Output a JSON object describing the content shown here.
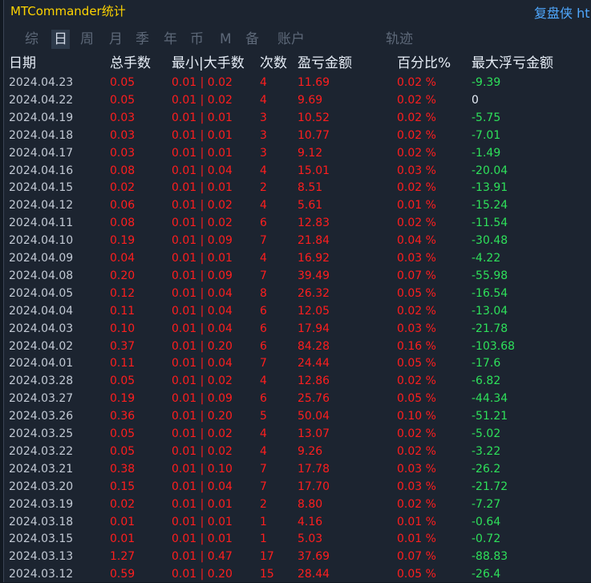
{
  "app": {
    "title": "MTCommander统计",
    "brand": "复盘侠 ht"
  },
  "tabs": [
    {
      "label": "综"
    },
    {
      "label": "日"
    },
    {
      "label": "周"
    },
    {
      "label": "月"
    },
    {
      "label": "季"
    },
    {
      "label": "年"
    },
    {
      "label": "币"
    },
    {
      "label": "M"
    },
    {
      "label": "备"
    },
    {
      "label": "账户"
    },
    {
      "label": "轨迹"
    }
  ],
  "active_tab": "日",
  "columns": {
    "date": "日期",
    "total_lots": "总手数",
    "min_max_lots": "最小|大手数",
    "count": "次数",
    "pnl": "盈亏金额",
    "percent": "百分比%",
    "max_float_loss": "最大浮亏金额"
  },
  "colors": {
    "background": "#1c2430",
    "title": "#ffd400",
    "brand": "#4fa8ff",
    "loss_red": "#ff1e1e",
    "float_green": "#2ee05a",
    "date_gray": "#c2c9d4"
  },
  "rows": [
    {
      "date": "2024.04.23",
      "lots": "0.05",
      "range": "0.01 | 0.02",
      "count": "4",
      "pnl": "11.69",
      "pct": "0.02 %",
      "float": "-9.39"
    },
    {
      "date": "2024.04.22",
      "lots": "0.05",
      "range": "0.01 | 0.02",
      "count": "4",
      "pnl": "9.69",
      "pct": "0.02 %",
      "float": "0"
    },
    {
      "date": "2024.04.19",
      "lots": "0.03",
      "range": "0.01 | 0.01",
      "count": "3",
      "pnl": "10.52",
      "pct": "0.02 %",
      "float": "-5.75"
    },
    {
      "date": "2024.04.18",
      "lots": "0.03",
      "range": "0.01 | 0.01",
      "count": "3",
      "pnl": "10.77",
      "pct": "0.02 %",
      "float": "-7.01"
    },
    {
      "date": "2024.04.17",
      "lots": "0.03",
      "range": "0.01 | 0.01",
      "count": "3",
      "pnl": "9.12",
      "pct": "0.02 %",
      "float": "-1.49"
    },
    {
      "date": "2024.04.16",
      "lots": "0.08",
      "range": "0.01 | 0.04",
      "count": "4",
      "pnl": "15.01",
      "pct": "0.03 %",
      "float": "-20.04"
    },
    {
      "date": "2024.04.15",
      "lots": "0.02",
      "range": "0.01 | 0.01",
      "count": "2",
      "pnl": "8.51",
      "pct": "0.02 %",
      "float": "-13.91"
    },
    {
      "date": "2024.04.12",
      "lots": "0.06",
      "range": "0.01 | 0.02",
      "count": "4",
      "pnl": "5.61",
      "pct": "0.01 %",
      "float": "-15.24"
    },
    {
      "date": "2024.04.11",
      "lots": "0.08",
      "range": "0.01 | 0.02",
      "count": "6",
      "pnl": "12.83",
      "pct": "0.02 %",
      "float": "-11.54"
    },
    {
      "date": "2024.04.10",
      "lots": "0.19",
      "range": "0.01 | 0.09",
      "count": "7",
      "pnl": "21.84",
      "pct": "0.04 %",
      "float": "-30.48"
    },
    {
      "date": "2024.04.09",
      "lots": "0.04",
      "range": "0.01 | 0.01",
      "count": "4",
      "pnl": "16.92",
      "pct": "0.03 %",
      "float": "-4.22"
    },
    {
      "date": "2024.04.08",
      "lots": "0.20",
      "range": "0.01 | 0.09",
      "count": "7",
      "pnl": "39.49",
      "pct": "0.07 %",
      "float": "-55.98"
    },
    {
      "date": "2024.04.05",
      "lots": "0.12",
      "range": "0.01 | 0.04",
      "count": "8",
      "pnl": "26.32",
      "pct": "0.05 %",
      "float": "-16.54"
    },
    {
      "date": "2024.04.04",
      "lots": "0.11",
      "range": "0.01 | 0.04",
      "count": "6",
      "pnl": "12.05",
      "pct": "0.02 %",
      "float": "-13.04"
    },
    {
      "date": "2024.04.03",
      "lots": "0.10",
      "range": "0.01 | 0.04",
      "count": "6",
      "pnl": "17.94",
      "pct": "0.03 %",
      "float": "-21.78"
    },
    {
      "date": "2024.04.02",
      "lots": "0.37",
      "range": "0.01 | 0.20",
      "count": "6",
      "pnl": "84.28",
      "pct": "0.16 %",
      "float": "-103.68"
    },
    {
      "date": "2024.04.01",
      "lots": "0.11",
      "range": "0.01 | 0.04",
      "count": "7",
      "pnl": "24.44",
      "pct": "0.05 %",
      "float": "-17.6"
    },
    {
      "date": "2024.03.28",
      "lots": "0.05",
      "range": "0.01 | 0.02",
      "count": "4",
      "pnl": "12.86",
      "pct": "0.02 %",
      "float": "-6.82"
    },
    {
      "date": "2024.03.27",
      "lots": "0.19",
      "range": "0.01 | 0.09",
      "count": "6",
      "pnl": "25.76",
      "pct": "0.05 %",
      "float": "-44.34"
    },
    {
      "date": "2024.03.26",
      "lots": "0.36",
      "range": "0.01 | 0.20",
      "count": "5",
      "pnl": "50.04",
      "pct": "0.10 %",
      "float": "-51.21"
    },
    {
      "date": "2024.03.25",
      "lots": "0.05",
      "range": "0.01 | 0.02",
      "count": "4",
      "pnl": "13.07",
      "pct": "0.02 %",
      "float": "-5.02"
    },
    {
      "date": "2024.03.22",
      "lots": "0.05",
      "range": "0.01 | 0.02",
      "count": "4",
      "pnl": "9.26",
      "pct": "0.02 %",
      "float": "-3.22"
    },
    {
      "date": "2024.03.21",
      "lots": "0.38",
      "range": "0.01 | 0.10",
      "count": "7",
      "pnl": "17.78",
      "pct": "0.03 %",
      "float": "-26.2"
    },
    {
      "date": "2024.03.20",
      "lots": "0.15",
      "range": "0.01 | 0.04",
      "count": "7",
      "pnl": "17.70",
      "pct": "0.03 %",
      "float": "-21.72"
    },
    {
      "date": "2024.03.19",
      "lots": "0.02",
      "range": "0.01 | 0.01",
      "count": "2",
      "pnl": "8.80",
      "pct": "0.02 %",
      "float": "-7.27"
    },
    {
      "date": "2024.03.18",
      "lots": "0.01",
      "range": "0.01 | 0.01",
      "count": "1",
      "pnl": "4.16",
      "pct": "0.01 %",
      "float": "-0.64"
    },
    {
      "date": "2024.03.15",
      "lots": "0.01",
      "range": "0.01 | 0.01",
      "count": "1",
      "pnl": "5.03",
      "pct": "0.01 %",
      "float": "-0.72"
    },
    {
      "date": "2024.03.13",
      "lots": "1.27",
      "range": "0.01 | 0.47",
      "count": "17",
      "pnl": "37.69",
      "pct": "0.07 %",
      "float": "-88.83"
    },
    {
      "date": "2024.03.12",
      "lots": "0.59",
      "range": "0.01 | 0.20",
      "count": "15",
      "pnl": "28.44",
      "pct": "0.05 %",
      "float": "-26.4"
    }
  ]
}
